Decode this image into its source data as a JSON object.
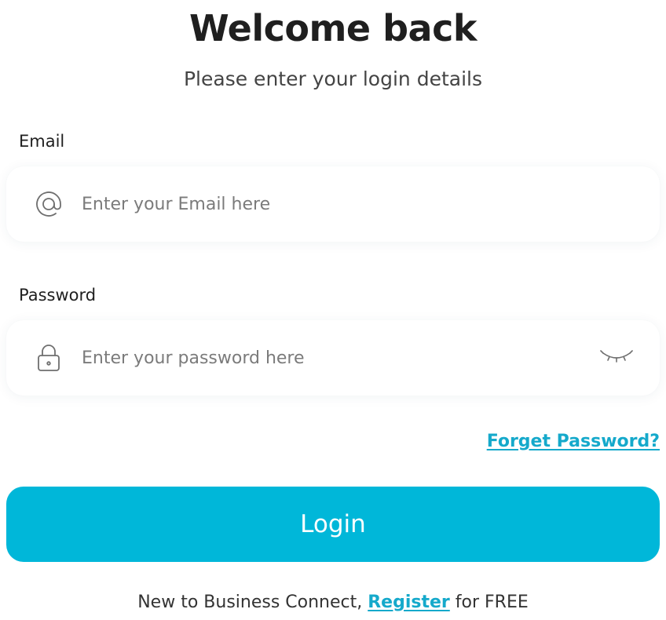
{
  "header": {
    "title": "Welcome back",
    "subtitle": "Please enter your login details"
  },
  "email": {
    "label": "Email",
    "placeholder": "Enter your Email here",
    "value": "",
    "icon": "at-icon"
  },
  "password": {
    "label": "Password",
    "placeholder": "Enter your password here",
    "value": "",
    "icon": "lock-icon",
    "toggle_icon": "eye-closed-icon"
  },
  "forget_password": {
    "label": "Forget Password?"
  },
  "login_button": {
    "label": "Login"
  },
  "footer": {
    "prefix": "New to Business Connect, ",
    "register_label": "Register",
    "suffix": " for FREE"
  },
  "colors": {
    "accent": "#00b7d9",
    "link": "#15a9cb",
    "text": "#1f1f1f"
  }
}
